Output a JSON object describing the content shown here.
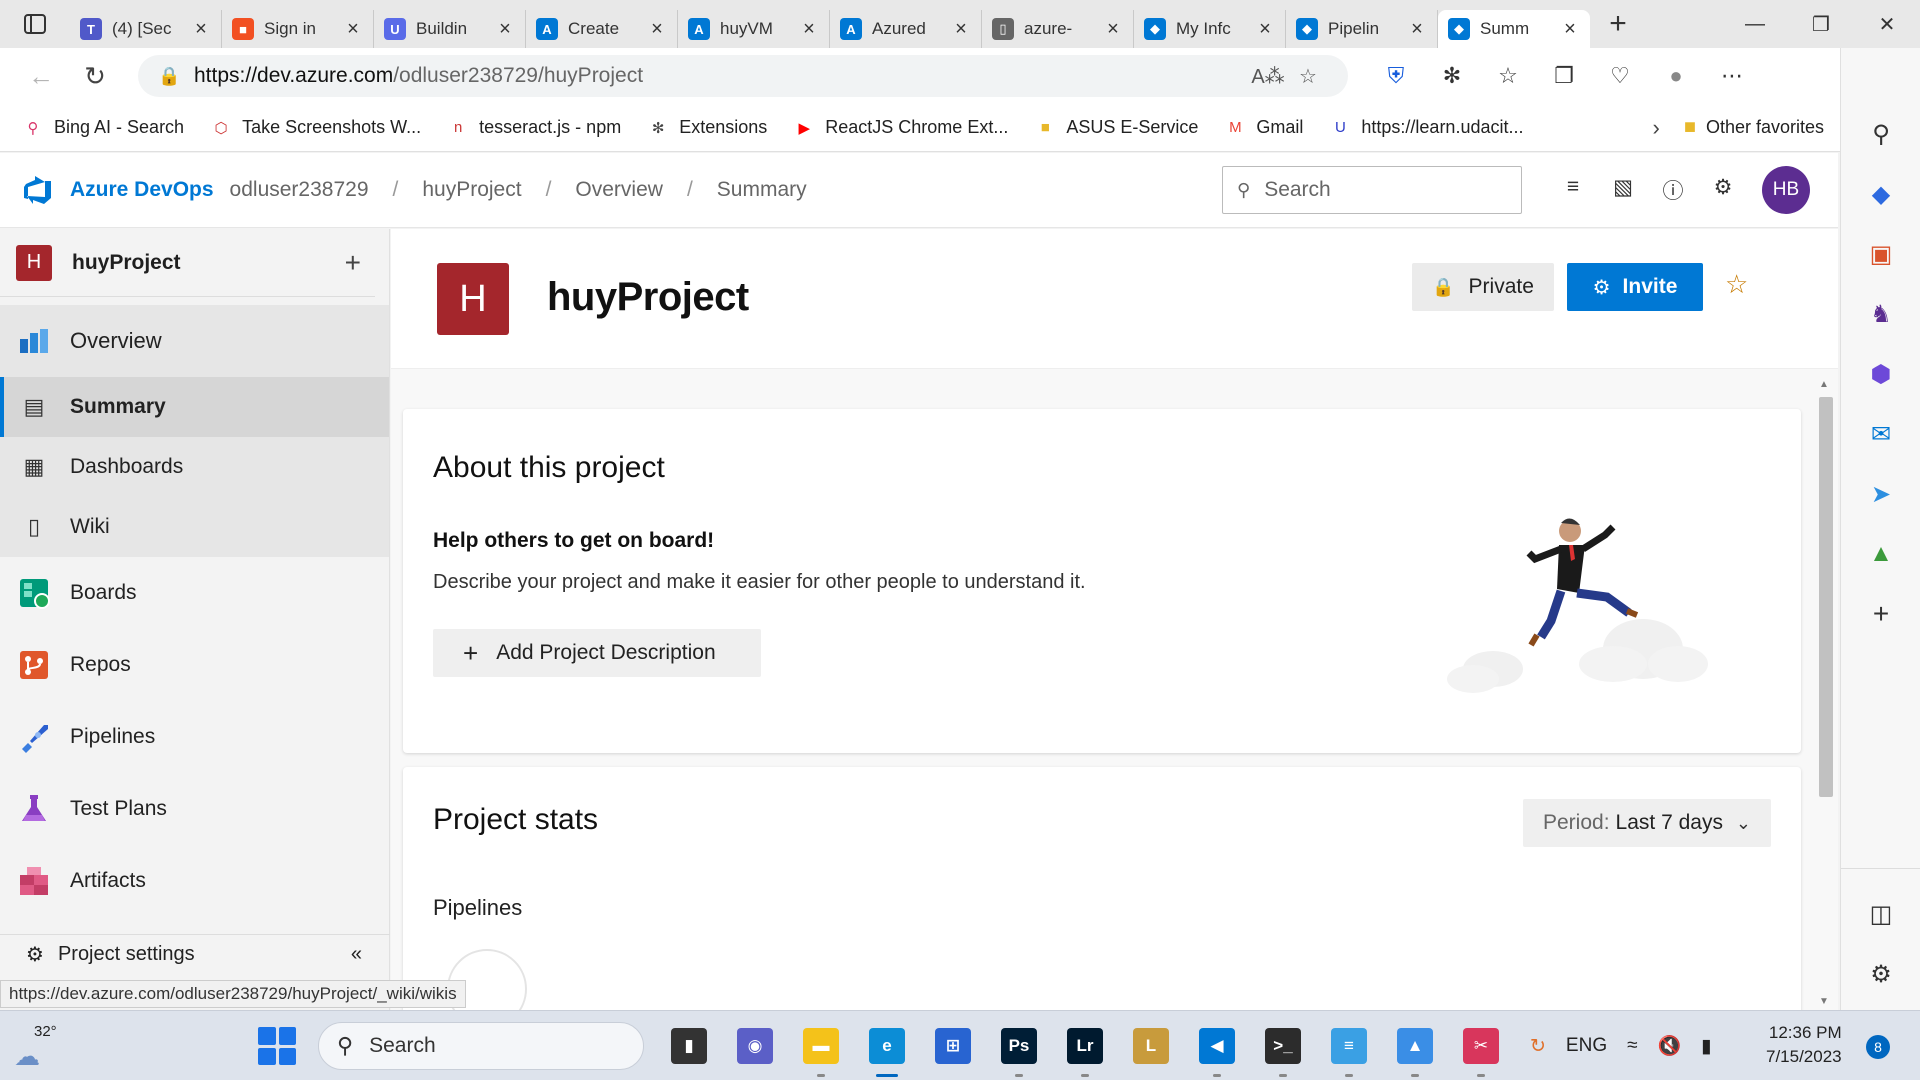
{
  "browser": {
    "tabs": [
      {
        "title": "(4) [Sec",
        "icon": "teams-icon",
        "color": "#5059c9",
        "glyph": "T"
      },
      {
        "title": "Sign in",
        "icon": "microsoft-icon",
        "color": "#f25022",
        "glyph": "■"
      },
      {
        "title": "Buildin",
        "icon": "udacity-icon",
        "color": "#5a6be8",
        "glyph": "U"
      },
      {
        "title": "Create",
        "icon": "azure-icon",
        "color": "#0078d4",
        "glyph": "A"
      },
      {
        "title": "huyVM",
        "icon": "azure-icon",
        "color": "#0078d4",
        "glyph": "A"
      },
      {
        "title": "Azured",
        "icon": "azure-icon",
        "color": "#0078d4",
        "glyph": "A"
      },
      {
        "title": "azure-",
        "icon": "document-icon",
        "color": "#666666",
        "glyph": "▯"
      },
      {
        "title": "My Infc",
        "icon": "devops-icon",
        "color": "#0078d4",
        "glyph": "◆"
      },
      {
        "title": "Pipelin",
        "icon": "devops-icon",
        "color": "#0078d4",
        "glyph": "◆"
      },
      {
        "title": "Summ",
        "icon": "devops-icon",
        "color": "#0078d4",
        "glyph": "◆",
        "active": true
      }
    ],
    "url_host": "https://dev.azure.com",
    "url_path": "/odluser238729/huyProject",
    "favorites": [
      {
        "label": "Bing AI - Search",
        "icon": "search-icon"
      },
      {
        "label": "Take Screenshots W...",
        "icon": "extension-icon"
      },
      {
        "label": "tesseract.js - npm",
        "icon": "npm-icon"
      },
      {
        "label": "Extensions",
        "icon": "puzzle-icon"
      },
      {
        "label": "ReactJS Chrome Ext...",
        "icon": "youtube-icon"
      },
      {
        "label": "ASUS E-Service",
        "icon": "folder-icon"
      },
      {
        "label": "Gmail",
        "icon": "gmail-icon"
      },
      {
        "label": "https://learn.udacit...",
        "icon": "udacity-icon"
      }
    ],
    "other_favorites": "Other favorites",
    "status_url": "https://dev.azure.com/odluser238729/huyProject/_wiki/wikis"
  },
  "header": {
    "brand": "Azure DevOps",
    "org": "odluser238729",
    "project": "huyProject",
    "section": "Overview",
    "page": "Summary",
    "search_placeholder": "Search",
    "avatar_initials": "HB"
  },
  "sidebar": {
    "project_initial": "H",
    "project_name": "huyProject",
    "items": [
      {
        "label": "Overview",
        "icon": "overview-icon"
      },
      {
        "label": "Summary",
        "icon": "summary-icon"
      },
      {
        "label": "Dashboards",
        "icon": "dashboards-icon"
      },
      {
        "label": "Wiki",
        "icon": "wiki-icon"
      },
      {
        "label": "Boards",
        "icon": "boards-icon"
      },
      {
        "label": "Repos",
        "icon": "repos-icon"
      },
      {
        "label": "Pipelines",
        "icon": "pipelines-icon"
      },
      {
        "label": "Test Plans",
        "icon": "test-plans-icon"
      },
      {
        "label": "Artifacts",
        "icon": "artifacts-icon"
      }
    ],
    "settings_label": "Project settings"
  },
  "main": {
    "project_initial": "H",
    "title": "huyProject",
    "private_label": "Private",
    "invite_label": "Invite",
    "about": {
      "heading": "About this project",
      "subheading": "Help others to get on board!",
      "description": "Describe your project and make it easier for other people to understand it.",
      "button": "Add Project Description"
    },
    "stats": {
      "heading": "Project stats",
      "period_prefix": "Period:",
      "period_value": "Last 7 days",
      "pipelines_label": "Pipelines"
    }
  },
  "taskbar": {
    "temperature": "32°",
    "search_label": "Search",
    "language": "ENG",
    "time": "12:36 PM",
    "date": "7/15/2023",
    "notifications": "8",
    "apps": [
      {
        "name": "desktop-app",
        "label": "▮",
        "color": "#333333"
      },
      {
        "name": "chat-app",
        "label": "◉",
        "color": "#5b5fc7"
      },
      {
        "name": "file-explorer-app",
        "label": "▬",
        "color": "#f4c21a"
      },
      {
        "name": "edge-app",
        "label": "e",
        "color": "#0c8dd6",
        "active": true
      },
      {
        "name": "store-app",
        "label": "⊞",
        "color": "#2864d1"
      },
      {
        "name": "photoshop-app",
        "label": "Ps",
        "color": "#001e36"
      },
      {
        "name": "lightroom-app",
        "label": "Lr",
        "color": "#001a2f"
      },
      {
        "name": "league-app",
        "label": "L",
        "color": "#c89b3c"
      },
      {
        "name": "vscode-app",
        "label": "◀",
        "color": "#0078d4"
      },
      {
        "name": "terminal-app",
        "label": ">_",
        "color": "#2c2c2c"
      },
      {
        "name": "notepad-app",
        "label": "≡",
        "color": "#3aa0e4"
      },
      {
        "name": "photos-app",
        "label": "▲",
        "color": "#3a8ee6"
      },
      {
        "name": "snipping-app",
        "label": "✂",
        "color": "#d8365c"
      }
    ]
  }
}
